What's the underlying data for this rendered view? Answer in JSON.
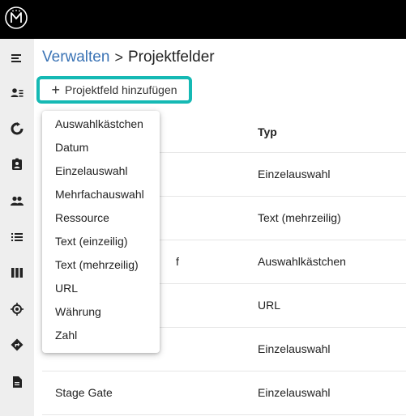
{
  "app": {
    "logo_icon": "monogram-logo-icon"
  },
  "breadcrumb": {
    "parent": "Verwalten",
    "separator": ">",
    "current": "Projektfelder"
  },
  "toolbar": {
    "add_label": "Projektfeld hinzufügen",
    "accent_color": "#15b9b4"
  },
  "sidebar": {
    "items": [
      {
        "icon": "menu-collapse-icon"
      },
      {
        "icon": "user-list-icon"
      },
      {
        "icon": "refresh-icon"
      },
      {
        "icon": "clipboard-user-icon"
      },
      {
        "icon": "people-icon"
      },
      {
        "icon": "list-icon"
      },
      {
        "icon": "columns-icon"
      },
      {
        "icon": "target-icon"
      },
      {
        "icon": "direction-icon"
      },
      {
        "icon": "document-icon"
      }
    ]
  },
  "table": {
    "header_type": "Typ",
    "rows": [
      {
        "name": "",
        "type": "Einzelauswahl"
      },
      {
        "name": "",
        "type": "Text (mehrzeilig)"
      },
      {
        "name": "f",
        "type": "Auswahlkästchen"
      },
      {
        "name": "",
        "type": "URL"
      },
      {
        "name": "",
        "type": "Einzelauswahl"
      },
      {
        "name": "Stage Gate",
        "type": "Einzelauswahl"
      }
    ]
  },
  "dropdown": {
    "options": [
      "Auswahlkästchen",
      "Datum",
      "Einzelauswahl",
      "Mehrfachauswahl",
      "Ressource",
      "Text (einzeilig)",
      "Text (mehrzeilig)",
      "URL",
      "Währung",
      "Zahl"
    ]
  }
}
